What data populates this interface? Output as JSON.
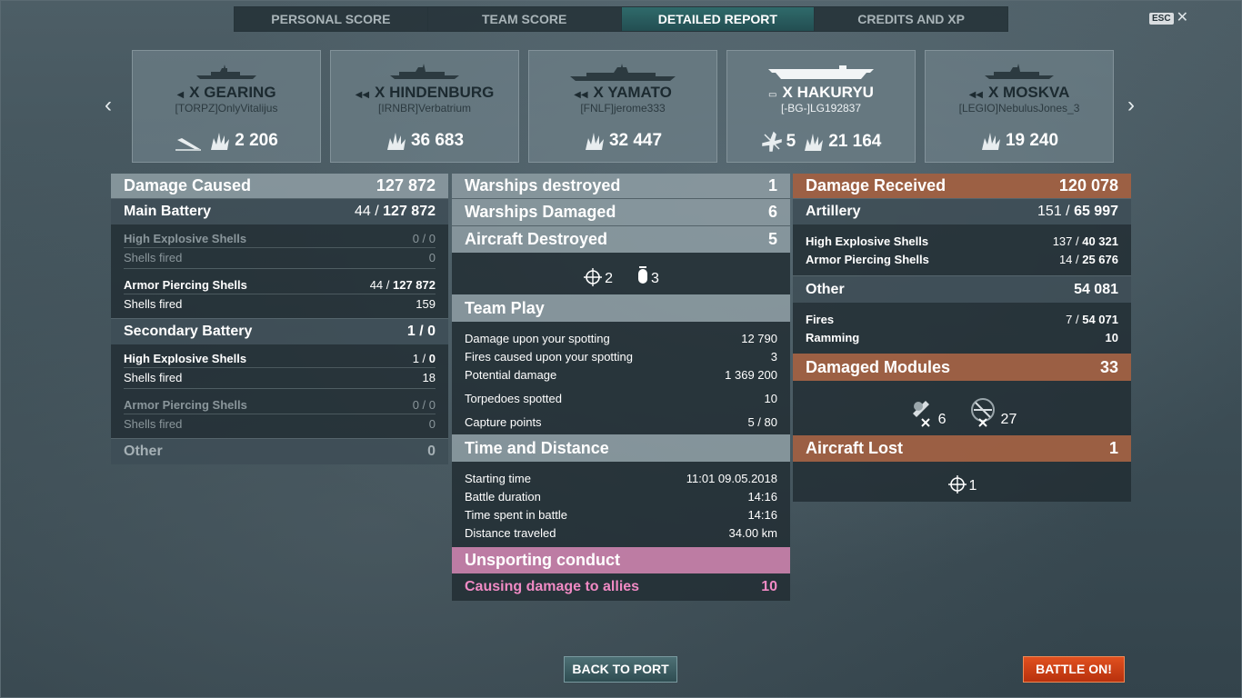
{
  "tabs": [
    "PERSONAL SCORE",
    "TEAM SCORE",
    "DETAILED REPORT",
    "CREDITS AND XP"
  ],
  "esc": {
    "key": "ESC",
    "close": "✕"
  },
  "carousel": {
    "prev": "‹",
    "next": "›",
    "ships": [
      {
        "tier": "X",
        "name": "GEARING",
        "player": "[TORPZ]OnlyVitalijus",
        "damage": "2 206",
        "kills": null
      },
      {
        "tier": "X",
        "name": "HINDENBURG",
        "player": "[IRNBR]Verbatrium",
        "damage": "36 683",
        "kills": null
      },
      {
        "tier": "X",
        "name": "YAMATO",
        "player": "[FNLF]jerome333",
        "damage": "32 447",
        "kills": null
      },
      {
        "tier": "X",
        "name": "HAKURYU",
        "player": "[-BG-]LG192837",
        "damage": "21 164",
        "kills": "5"
      },
      {
        "tier": "X",
        "name": "MOSKVA",
        "player": "[LEGIO]NebulusJones_3",
        "damage": "19 240",
        "kills": null
      }
    ]
  },
  "left": {
    "damage_caused": {
      "label": "Damage Caused",
      "value": "127 872"
    },
    "main_battery": {
      "label": "Main Battery",
      "hits": "44 / ",
      "value": "127 872"
    },
    "mb_he": {
      "label": "High Explosive Shells",
      "value": "0 / 0"
    },
    "mb_he_fired": {
      "label": "Shells fired",
      "value": "0"
    },
    "mb_ap": {
      "label": "Armor Piercing Shells",
      "hits": "44 / ",
      "value": "127 872"
    },
    "mb_ap_fired": {
      "label": "Shells fired",
      "value": "159"
    },
    "secondary": {
      "label": "Secondary Battery",
      "value": "1 / 0"
    },
    "sb_he": {
      "label": "High Explosive Shells",
      "hits": "1 / ",
      "value": "0"
    },
    "sb_he_fired": {
      "label": "Shells fired",
      "value": "18"
    },
    "sb_ap": {
      "label": "Armor Piercing Shells",
      "value": "0 / 0"
    },
    "sb_ap_fired": {
      "label": "Shells fired",
      "value": "0"
    },
    "other": {
      "label": "Other",
      "value": "0"
    }
  },
  "middle": {
    "warships_destroyed": {
      "label": "Warships destroyed",
      "value": "1"
    },
    "warships_damaged": {
      "label": "Warships Damaged",
      "value": "6"
    },
    "aircraft_destroyed": {
      "label": "Aircraft Destroyed",
      "value": "5"
    },
    "aircraft_icons": {
      "fighters": "2",
      "bombers": "3"
    },
    "team_play": {
      "label": "Team Play"
    },
    "tp_rows": [
      {
        "label": "Damage upon your spotting",
        "value": "12 790"
      },
      {
        "label": "Fires caused upon your spotting",
        "value": "3"
      },
      {
        "label": "Potential damage",
        "value": "1 369 200"
      },
      {
        "label": "Torpedoes spotted",
        "value": "10"
      },
      {
        "label": "Capture points",
        "value": "5 / 80"
      }
    ],
    "time_distance": {
      "label": "Time and Distance"
    },
    "td_rows": [
      {
        "label": "Starting time",
        "value": "11:01  09.05.2018"
      },
      {
        "label": "Battle duration",
        "value": "14:16"
      },
      {
        "label": "Time spent in battle",
        "value": "14:16"
      },
      {
        "label": "Distance traveled",
        "value": "34.00 km"
      }
    ],
    "unsporting": {
      "label": "Unsporting conduct"
    },
    "ally_damage": {
      "label": "Causing damage to allies",
      "value": "10"
    }
  },
  "right": {
    "damage_received": {
      "label": "Damage Received",
      "value": "120 078"
    },
    "artillery": {
      "label": "Artillery",
      "hits": "151 / ",
      "value": "65 997"
    },
    "art_he": {
      "label": "High Explosive Shells",
      "hits": "137 / ",
      "value": "40 321"
    },
    "art_ap": {
      "label": "Armor Piercing Shells",
      "hits": "14 / ",
      "value": "25 676"
    },
    "other": {
      "label": "Other",
      "value": "54 081"
    },
    "fires": {
      "label": "Fires",
      "hits": "7 / ",
      "value": "54 071"
    },
    "ramming": {
      "label": "Ramming",
      "value": "10"
    },
    "damaged_modules": {
      "label": "Damaged Modules",
      "value": "33"
    },
    "modules": {
      "guns": "6",
      "aa": "27"
    },
    "aircraft_lost": {
      "label": "Aircraft Lost",
      "value": "1"
    },
    "aircraft_lost_icons": {
      "fighters": "1"
    }
  },
  "buttons": {
    "back": "BACK TO PORT",
    "battle": "BATTLE ON!"
  }
}
